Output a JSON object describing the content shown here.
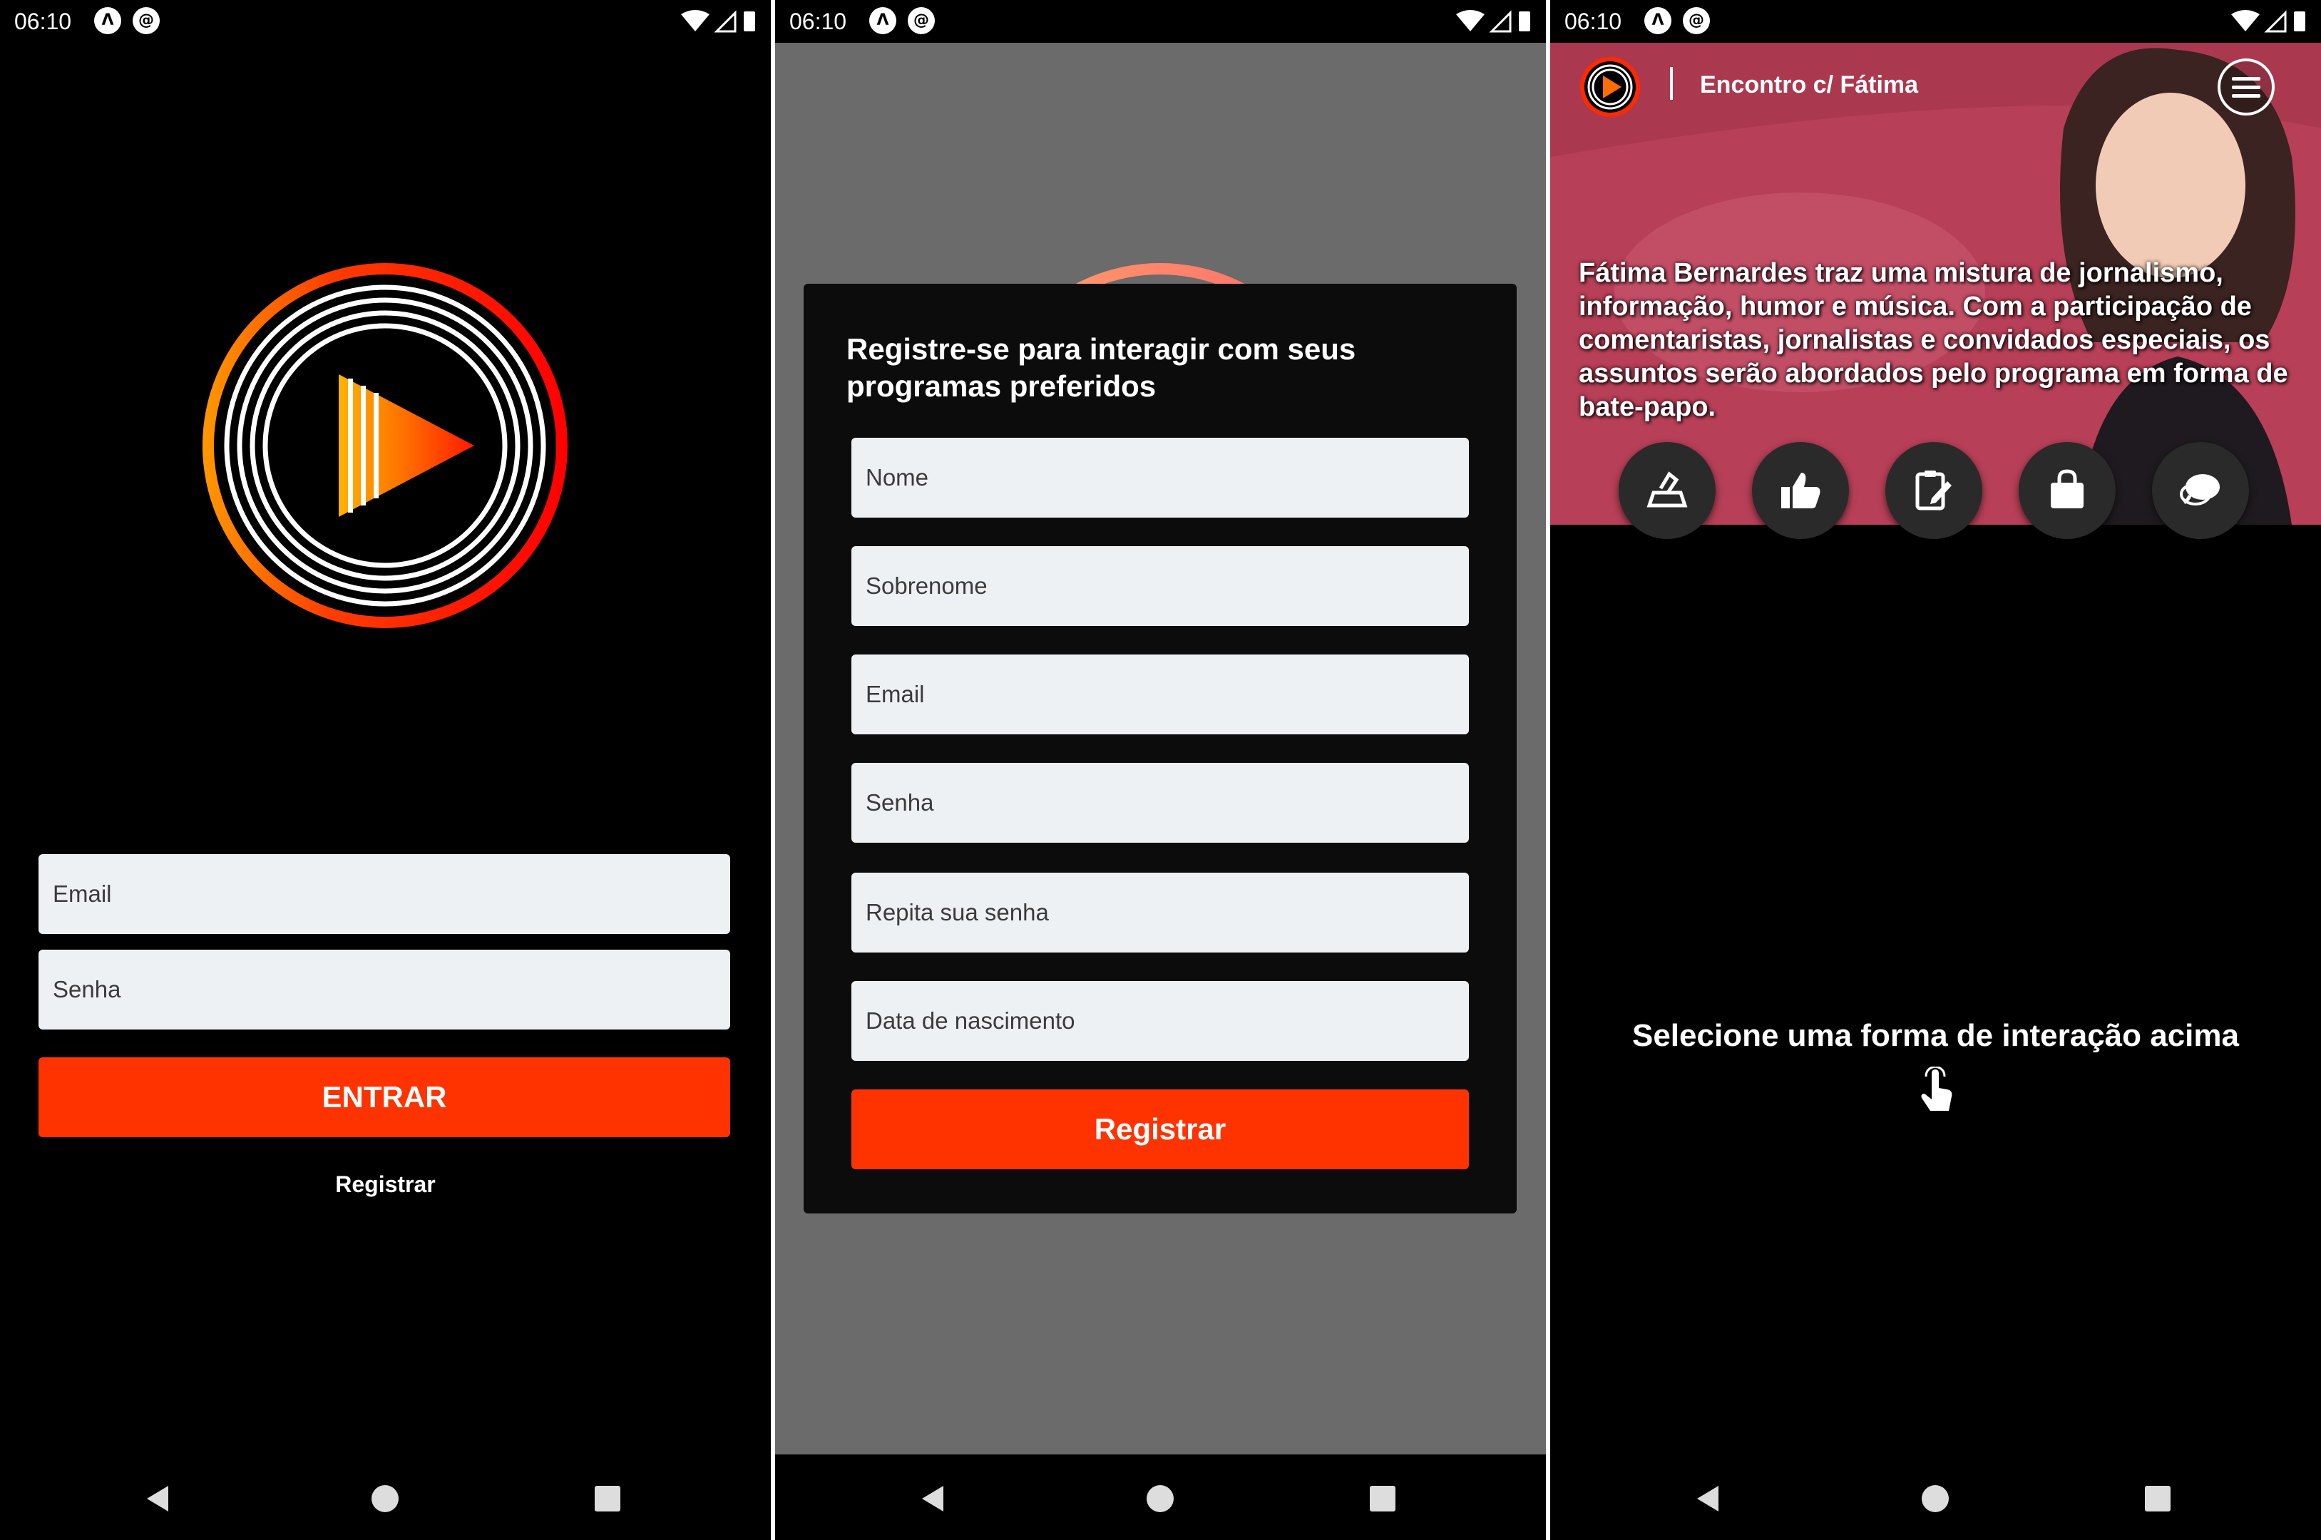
{
  "status_bar": {
    "time": "06:10"
  },
  "login": {
    "email_placeholder": "Email",
    "password_placeholder": "Senha",
    "enter_button": "ENTRAR",
    "register_link": "Registrar"
  },
  "register_modal": {
    "title": "Registre-se para interagir com seus programas preferidos",
    "fields": [
      "Nome",
      "Sobrenome",
      "Email",
      "Senha",
      "Repita sua senha",
      "Data de nascimento"
    ],
    "submit_button": "Registrar"
  },
  "program": {
    "title": "Encontro c/ Fátima",
    "description": "Fátima Bernardes traz uma mistura de jornalismo, informação, humor e música. Com a participação de comentaristas, jornalistas e convidados especiais, os assuntos serão abordados pelo programa em forma de bate-papo.",
    "actions": [
      "vote-icon",
      "like-icon",
      "survey-icon",
      "shopping-bag-icon",
      "chat-icon"
    ],
    "prompt": "Selecione uma forma de interação acima"
  },
  "colors": {
    "accent": "#ff3300",
    "input_bg": "#eef1f4",
    "background": "#000000"
  }
}
